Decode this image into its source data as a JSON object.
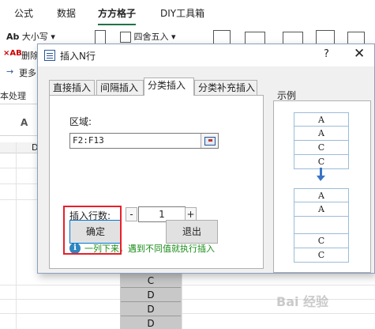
{
  "ribbon": {
    "tabs": [
      "公式",
      "数据",
      "方方格子",
      "DIY工具箱"
    ],
    "items": {
      "case": "大小写",
      "case_prefix": "Ab",
      "delete": "删除",
      "delete_prefix": "×AB",
      "more": "更多",
      "round": "四舍五入",
      "group_label": "本处理"
    }
  },
  "sheet": {
    "font_btn": "A",
    "col_d": "D",
    "cells": [
      "C",
      "D",
      "D",
      "D"
    ]
  },
  "dialog": {
    "title": "插入N行",
    "help": "?",
    "close": "✕",
    "tabs": [
      "直接插入",
      "间隔插入",
      "分类插入",
      "分类补充插入"
    ],
    "active_tab": 2,
    "range_label": "区域:",
    "range_value": "F2:F13",
    "rows_label": "插入行数:",
    "minus": "-",
    "rows_value": "1",
    "plus": "+",
    "hint": "一列下来，遇到不同值就执行插入",
    "ok": "确定",
    "cancel": "退出",
    "example_label": "示例",
    "example_before": [
      "A",
      "A",
      "C",
      "C"
    ],
    "example_after": [
      "A",
      "A",
      "",
      "C",
      "C"
    ]
  },
  "watermark": "Bai 经验"
}
